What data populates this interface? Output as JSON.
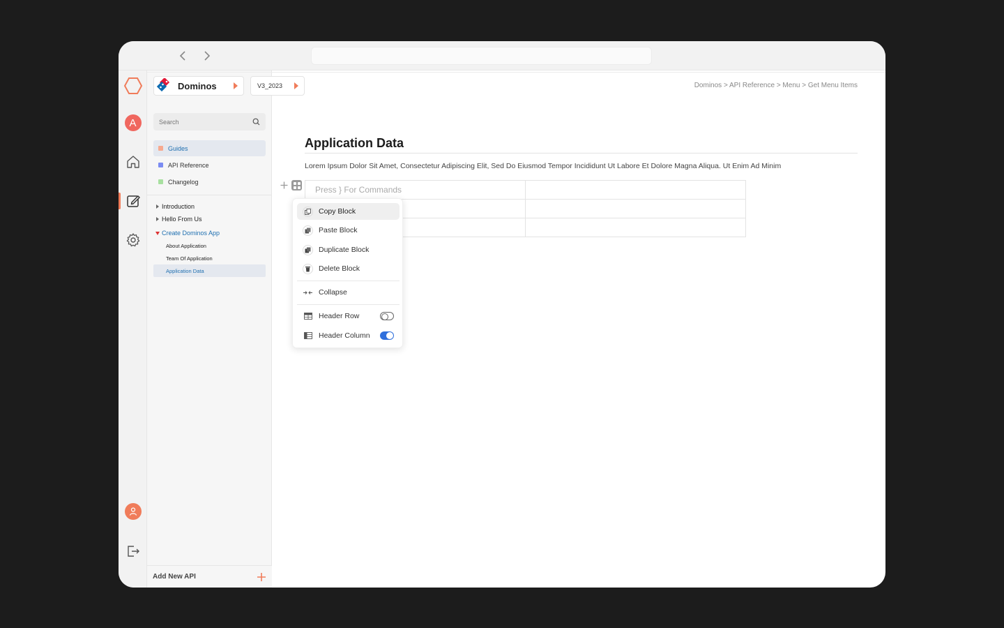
{
  "project": {
    "name": "Dominos"
  },
  "version": {
    "name": "V3_2023"
  },
  "breadcrumb": "Dominos  >  API Reference > Menu > Get Menu Items",
  "user": {
    "initial": "A"
  },
  "search": {
    "placeholder": "Search"
  },
  "categories": [
    {
      "label": "Guides",
      "color": "#f7a98f",
      "active": true
    },
    {
      "label": "API Reference",
      "color": "#7b8cf2",
      "active": false
    },
    {
      "label": "Changelog",
      "color": "#a8e0a0",
      "active": false
    }
  ],
  "tree": {
    "items": [
      "Introduction",
      "Hello From Us",
      "Create Dominos App"
    ],
    "children": [
      "About Application",
      "Team Of Application",
      "Application Data"
    ]
  },
  "sidebar_footer": {
    "label": "Add New API"
  },
  "page": {
    "title": "Application Data",
    "description": "Lorem Ipsum Dolor Sit Amet, Consectetur Adipiscing Elit, Sed Do Eiusmod Tempor Incididunt Ut Labore Et Dolore Magna Aliqua. Ut Enim Ad Minim"
  },
  "table": {
    "placeholder": "Press } For Commands"
  },
  "context_menu": {
    "copy": "Copy Block",
    "paste": "Paste Block",
    "duplicate": "Duplicate Block",
    "delete": "Delete Block",
    "collapse": "Collapse",
    "header_row": {
      "label": "Header Row",
      "enabled": false
    },
    "header_column": {
      "label": "Header Column",
      "enabled": true
    }
  },
  "colors": {
    "accent": "#f07c5a",
    "link": "#1f6fb0",
    "toggle_on": "#2f6fdc"
  }
}
